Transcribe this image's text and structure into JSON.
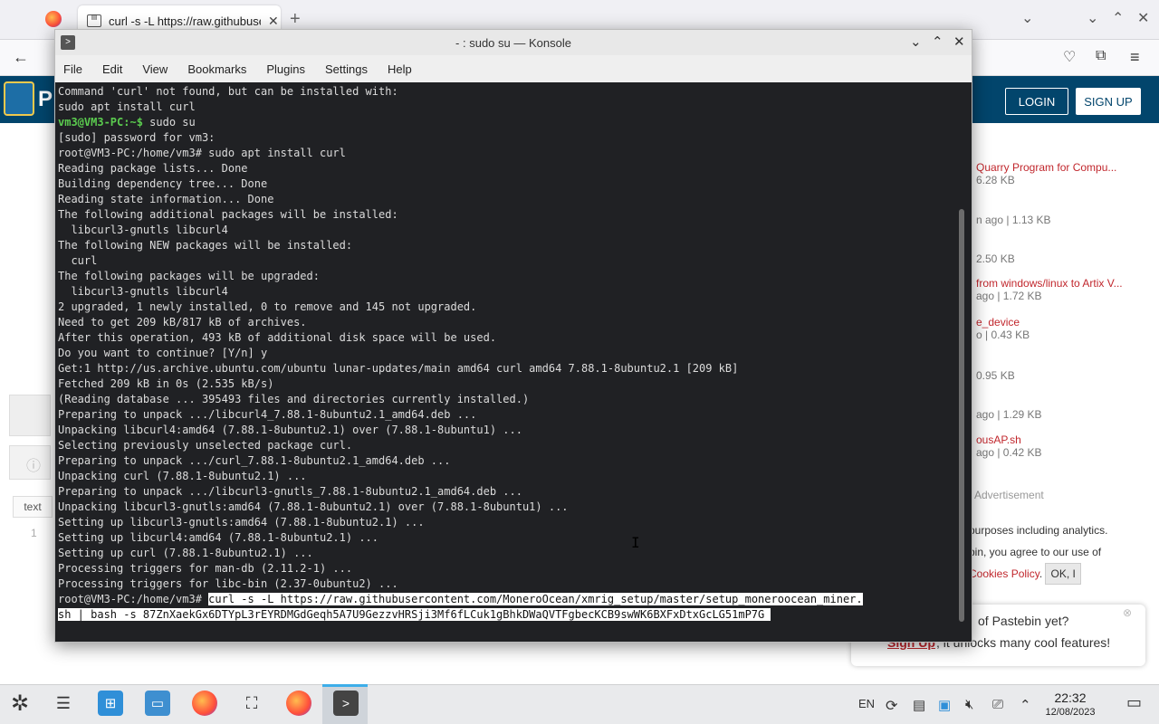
{
  "browser": {
    "tab_title": "curl -s -L https://raw.githubusercontent.com",
    "new_tab_icon": "plus-icon"
  },
  "pastebin": {
    "login": "LOGIN",
    "signup": "SIGN UP",
    "logo_letter": "P",
    "recent": [
      {
        "name": "Quarry Program for Compu...",
        "meta": "6.28 KB"
      },
      {
        "name": "",
        "meta": "n ago | 1.13 KB"
      },
      {
        "name": "",
        "meta": "2.50 KB"
      },
      {
        "name": "from windows/linux to Artix V...",
        "meta": "ago | 1.72 KB"
      },
      {
        "name": "e_device",
        "meta": "o | 0.43 KB"
      },
      {
        "name": "",
        "meta": "0.95 KB"
      },
      {
        "name": "",
        "meta": "ago | 1.29 KB"
      },
      {
        "name": "ousAP.sh",
        "meta": "ago | 0.42 KB"
      }
    ],
    "advertisement": "Advertisement",
    "cookie_line1": "purposes including analytics.",
    "cookie_line2": "bin, you agree to our use of",
    "cookie_link": "Cookies Policy",
    "cookie_ok": "OK, I",
    "promo_text1": "of Pastebin yet?",
    "promo_link": "Sign Up",
    "promo_text2": ", it unlocks many cool features!",
    "left_tab": "text",
    "left_num": "1"
  },
  "konsole": {
    "title": "- : sudo su — Konsole",
    "menu": [
      "File",
      "Edit",
      "View",
      "Bookmarks",
      "Plugins",
      "Settings",
      "Help"
    ],
    "lines": [
      {
        "t": "Command 'curl' not found, but can be installed with:"
      },
      {
        "t": "sudo apt install curl"
      },
      {
        "prompt": "vm3@VM3-PC:~$",
        "t": " sudo su"
      },
      {
        "t": "[sudo] password for vm3:"
      },
      {
        "t": "root@VM3-PC:/home/vm3# sudo apt install curl"
      },
      {
        "t": "Reading package lists... Done"
      },
      {
        "t": "Building dependency tree... Done"
      },
      {
        "t": "Reading state information... Done"
      },
      {
        "t": "The following additional packages will be installed:"
      },
      {
        "t": "  libcurl3-gnutls libcurl4"
      },
      {
        "t": "The following NEW packages will be installed:"
      },
      {
        "t": "  curl"
      },
      {
        "t": "The following packages will be upgraded:"
      },
      {
        "t": "  libcurl3-gnutls libcurl4"
      },
      {
        "t": "2 upgraded, 1 newly installed, 0 to remove and 145 not upgraded."
      },
      {
        "t": "Need to get 209 kB/817 kB of archives."
      },
      {
        "t": "After this operation, 493 kB of additional disk space will be used."
      },
      {
        "t": "Do you want to continue? [Y/n] y"
      },
      {
        "t": "Get:1 http://us.archive.ubuntu.com/ubuntu lunar-updates/main amd64 curl amd64 7.88.1-8ubuntu2.1 [209 kB]"
      },
      {
        "t": "Fetched 209 kB in 0s (2.535 kB/s)"
      },
      {
        "t": "(Reading database ... 395493 files and directories currently installed.)"
      },
      {
        "t": "Preparing to unpack .../libcurl4_7.88.1-8ubuntu2.1_amd64.deb ..."
      },
      {
        "t": "Unpacking libcurl4:amd64 (7.88.1-8ubuntu2.1) over (7.88.1-8ubuntu1) ..."
      },
      {
        "t": "Selecting previously unselected package curl."
      },
      {
        "t": "Preparing to unpack .../curl_7.88.1-8ubuntu2.1_amd64.deb ..."
      },
      {
        "t": "Unpacking curl (7.88.1-8ubuntu2.1) ..."
      },
      {
        "t": "Preparing to unpack .../libcurl3-gnutls_7.88.1-8ubuntu2.1_amd64.deb ..."
      },
      {
        "t": "Unpacking libcurl3-gnutls:amd64 (7.88.1-8ubuntu2.1) over (7.88.1-8ubuntu1) ..."
      },
      {
        "t": "Setting up libcurl3-gnutls:amd64 (7.88.1-8ubuntu2.1) ..."
      },
      {
        "t": "Setting up libcurl4:amd64 (7.88.1-8ubuntu2.1) ..."
      },
      {
        "t": "Setting up curl (7.88.1-8ubuntu2.1) ..."
      },
      {
        "t": "Processing triggers for man-db (2.11.2-1) ..."
      },
      {
        "t": "Processing triggers for libc-bin (2.37-0ubuntu2) ..."
      },
      {
        "t": "root@VM3-PC:/home/vm3# ",
        "sel": "curl -s -L https://raw.githubusercontent.com/MoneroOcean/xmrig_setup/master/setup_moneroocean_miner."
      },
      {
        "t": "",
        "sel": "sh | bash -s 87ZnXaekGx6DTYpL3rEYRDMGdGeqh5A7U9GezzvHRSji3Mf6fLCuk1gBhkDWaQVTFgbecKCB9swWK6BXFxDtxGcLG51mP7G "
      }
    ]
  },
  "taskbar": {
    "lang": "EN",
    "time": "22:32",
    "date": "12/08/2023"
  },
  "colors": {
    "terminal_bg": "#202124",
    "prompt_green": "#5bcc4f",
    "pastebin_blue": "#02456c"
  }
}
